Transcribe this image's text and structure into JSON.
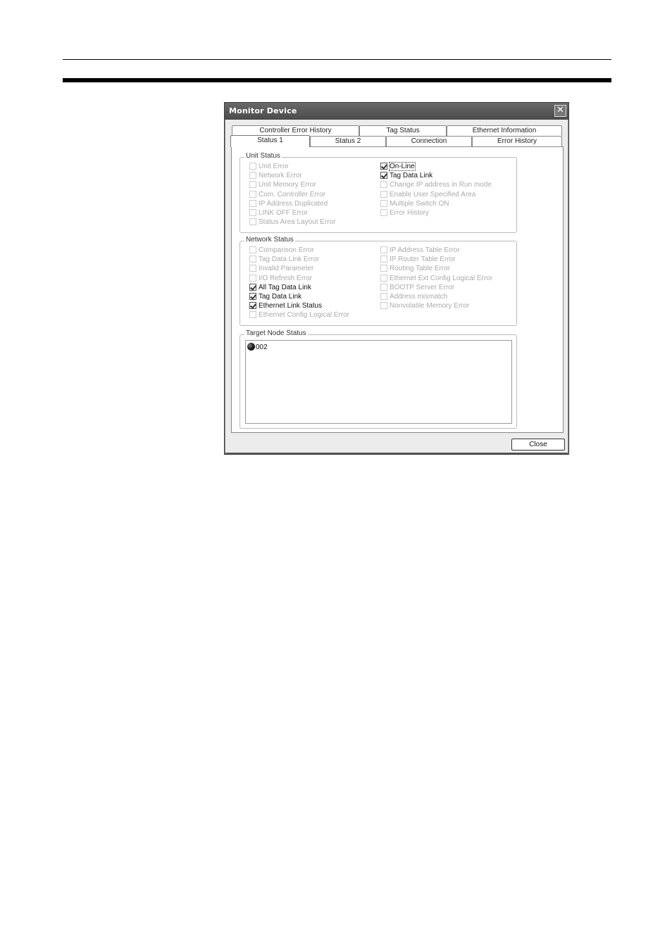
{
  "window": {
    "title": "Monitor Device",
    "close_glyph": "✕"
  },
  "tabs_row1": [
    {
      "label": "Controller Error History"
    },
    {
      "label": "Tag Status"
    },
    {
      "label": "Ethernet Information"
    }
  ],
  "tabs_row2": [
    {
      "label": "Status 1",
      "active": true
    },
    {
      "label": "Status 2"
    },
    {
      "label": "Connection"
    },
    {
      "label": "Error History"
    }
  ],
  "unit_status": {
    "title": "Unit Status",
    "left": [
      {
        "label": "Unit Error",
        "checked": false
      },
      {
        "label": "Network Error",
        "checked": false
      },
      {
        "label": "Unit Memory Error",
        "checked": false
      },
      {
        "label": "Com. Controller Error",
        "checked": false
      },
      {
        "label": "IP Address Duplicated",
        "checked": false
      },
      {
        "label": "LINK OFF Error",
        "checked": false
      },
      {
        "label": "Status Area Layout Error",
        "checked": false
      }
    ],
    "right": [
      {
        "label": "On-Line",
        "checked": true
      },
      {
        "label": "Tag Data Link",
        "checked": true
      },
      {
        "label": "Change IP address in Run mode",
        "checked": false
      },
      {
        "label": "Enable User Specified Area",
        "checked": false
      },
      {
        "label": "Multiple Switch ON",
        "checked": false
      },
      {
        "label": "Error History",
        "checked": false
      }
    ]
  },
  "network_status": {
    "title": "Network Status",
    "left": [
      {
        "label": "Comparison Error",
        "checked": false
      },
      {
        "label": "Tag Data Link Error",
        "checked": false
      },
      {
        "label": "Invalid Parameter",
        "checked": false
      },
      {
        "label": "I/O Refresh Error",
        "checked": false
      },
      {
        "label": "All Tag Data Link",
        "checked": true
      },
      {
        "label": "Tag Data Link",
        "checked": true
      },
      {
        "label": "Ethernet Link Status",
        "checked": true
      },
      {
        "label": "Ethernet Config Logical Error",
        "checked": false
      }
    ],
    "right": [
      {
        "label": "IP Address Table Error",
        "checked": false
      },
      {
        "label": "IP Router Table Error",
        "checked": false
      },
      {
        "label": "Routing Table Error",
        "checked": false
      },
      {
        "label": "Ethernet Ext Config Logical Error",
        "checked": false
      },
      {
        "label": "BOOTP Server Error",
        "checked": false
      },
      {
        "label": "Address mismatch",
        "checked": false
      },
      {
        "label": "Nonvolatile Memory Error",
        "checked": false
      }
    ]
  },
  "target_node_status": {
    "title": "Target Node Status",
    "nodes": [
      {
        "label": "002",
        "icon": "status-dot-icon"
      }
    ]
  },
  "buttons": {
    "close": "Close"
  }
}
